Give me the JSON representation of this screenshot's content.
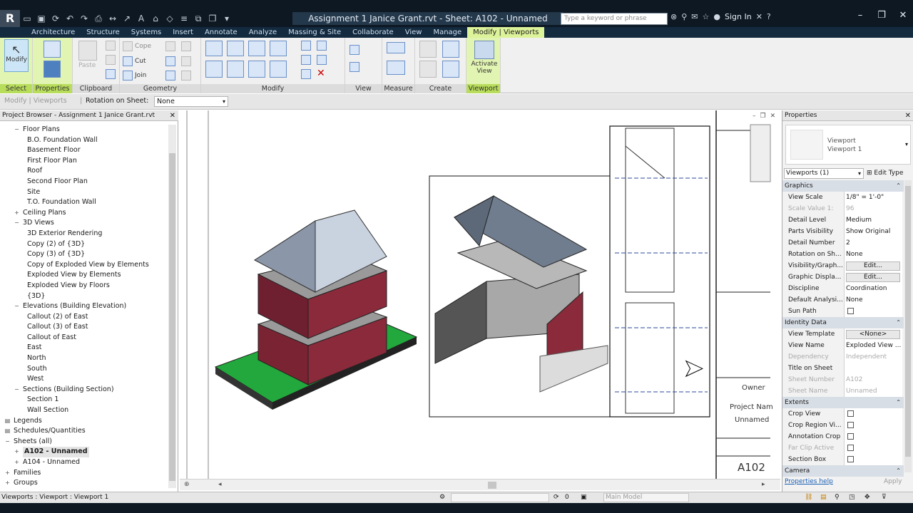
{
  "app": {
    "logo": "R",
    "title": "Assignment 1 Janice Grant.rvt - Sheet: A102 - Unnamed"
  },
  "search": {
    "placeholder": "Type a keyword or phrase"
  },
  "account": {
    "sign_in": "Sign In"
  },
  "tabs": [
    {
      "label": "Architecture"
    },
    {
      "label": "Structure"
    },
    {
      "label": "Systems"
    },
    {
      "label": "Insert"
    },
    {
      "label": "Annotate"
    },
    {
      "label": "Analyze"
    },
    {
      "label": "Massing & Site"
    },
    {
      "label": "Collaborate"
    },
    {
      "label": "View"
    },
    {
      "label": "Manage"
    },
    {
      "label": "Modify | Viewports"
    }
  ],
  "ribbon": {
    "modify_label": "Modify",
    "paste_label": "Paste",
    "cut_label": "Cut",
    "join_label": "Join",
    "cope_label": "Cope",
    "activate_view_label": "Activate View",
    "panels": {
      "select": "Select",
      "properties": "Properties",
      "clipboard": "Clipboard",
      "geometry": "Geometry",
      "modify": "Modify",
      "view": "View",
      "measure": "Measure",
      "create": "Create",
      "viewport": "Viewport"
    }
  },
  "options_bar": {
    "context": "Modify | Viewports",
    "rotation_label": "Rotation on Sheet:",
    "rotation_value": "None"
  },
  "project_browser": {
    "title": "Project Browser - Assignment 1 Janice Grant.rvt",
    "items": [
      {
        "label": "Floor Plans",
        "level": 1,
        "toggle": "minus"
      },
      {
        "label": "B.O. Foundation Wall",
        "level": 2
      },
      {
        "label": "Basement Floor",
        "level": 2
      },
      {
        "label": "First Floor Plan",
        "level": 2
      },
      {
        "label": "Roof",
        "level": 2
      },
      {
        "label": "Second Floor Plan",
        "level": 2
      },
      {
        "label": "Site",
        "level": 2
      },
      {
        "label": "T.O. Foundation Wall",
        "level": 2
      },
      {
        "label": "Ceiling Plans",
        "level": 1,
        "toggle": "plus"
      },
      {
        "label": "3D Views",
        "level": 1,
        "toggle": "minus"
      },
      {
        "label": "3D Exterior Rendering",
        "level": 2
      },
      {
        "label": "Copy (2) of {3D}",
        "level": 2
      },
      {
        "label": "Copy (3) of {3D}",
        "level": 2
      },
      {
        "label": "Copy of Exploded View by Elements",
        "level": 2
      },
      {
        "label": "Exploded View by Elements",
        "level": 2
      },
      {
        "label": "Exploded View by Floors",
        "level": 2
      },
      {
        "label": "{3D}",
        "level": 2
      },
      {
        "label": "Elevations (Building Elevation)",
        "level": 1,
        "toggle": "minus"
      },
      {
        "label": "Callout (2) of East",
        "level": 2
      },
      {
        "label": "Callout (3) of East",
        "level": 2
      },
      {
        "label": "Callout of East",
        "level": 2
      },
      {
        "label": "East",
        "level": 2
      },
      {
        "label": "North",
        "level": 2
      },
      {
        "label": "South",
        "level": 2
      },
      {
        "label": "West",
        "level": 2
      },
      {
        "label": "Sections (Building Section)",
        "level": 1,
        "toggle": "minus"
      },
      {
        "label": "Section 1",
        "level": 2
      },
      {
        "label": "Wall Section",
        "level": 2
      },
      {
        "label": "Legends",
        "level": 0,
        "toggle": "icon"
      },
      {
        "label": "Schedules/Quantities",
        "level": 0,
        "toggle": "icon"
      },
      {
        "label": "Sheets (all)",
        "level": 0,
        "toggle": "minus"
      },
      {
        "label": "A102 - Unnamed",
        "level": 1,
        "toggle": "plus",
        "selected": true
      },
      {
        "label": "A104 - Unnamed",
        "level": 1,
        "toggle": "plus"
      },
      {
        "label": "Families",
        "level": 0,
        "toggle": "plus"
      },
      {
        "label": "Groups",
        "level": 0,
        "toggle": "plus"
      }
    ]
  },
  "sheet": {
    "owner": "Owner",
    "project_name": "Project Nam",
    "unnamed": "Unnamed",
    "number": "A102"
  },
  "properties": {
    "title": "Properties",
    "type_family": "Viewport",
    "type_name": "Viewport 1",
    "selector": "Viewports (1)",
    "edit_type": "Edit Type",
    "rows": [
      {
        "group": "Graphics"
      },
      {
        "key": "View Scale",
        "value": "1/8\" = 1'-0\""
      },
      {
        "key": "Scale Value    1:",
        "value": "96",
        "dim": true
      },
      {
        "key": "Detail Level",
        "value": "Medium"
      },
      {
        "key": "Parts Visibility",
        "value": "Show Original"
      },
      {
        "key": "Detail Number",
        "value": "2"
      },
      {
        "key": "Rotation on Sh...",
        "value": "None"
      },
      {
        "key": "Visibility/Graph...",
        "button": "Edit..."
      },
      {
        "key": "Graphic Displa...",
        "button": "Edit..."
      },
      {
        "key": "Discipline",
        "value": "Coordination"
      },
      {
        "key": "Default Analysi...",
        "value": "None"
      },
      {
        "key": "Sun Path",
        "check": true
      },
      {
        "group": "Identity Data"
      },
      {
        "key": "View Template",
        "button": "<None>"
      },
      {
        "key": "View Name",
        "value": "Exploded View ..."
      },
      {
        "key": "Dependency",
        "value": "Independent",
        "dim": true
      },
      {
        "key": "Title on Sheet",
        "value": ""
      },
      {
        "key": "Sheet Number",
        "value": "A102",
        "dim": true
      },
      {
        "key": "Sheet Name",
        "value": "Unnamed",
        "dim": true
      },
      {
        "group": "Extents"
      },
      {
        "key": "Crop View",
        "check": true
      },
      {
        "key": "Crop Region Vi...",
        "check": true
      },
      {
        "key": "Annotation Crop",
        "check": true
      },
      {
        "key": "Far Clip Active",
        "check": true,
        "dim": true
      },
      {
        "key": "Section Box",
        "check": true
      },
      {
        "group": "Camera"
      }
    ],
    "help_link": "Properties help",
    "apply": "Apply"
  },
  "status": {
    "text": "Viewports : Viewport : Viewport 1",
    "selection_count": "0",
    "model": "Main Model"
  }
}
